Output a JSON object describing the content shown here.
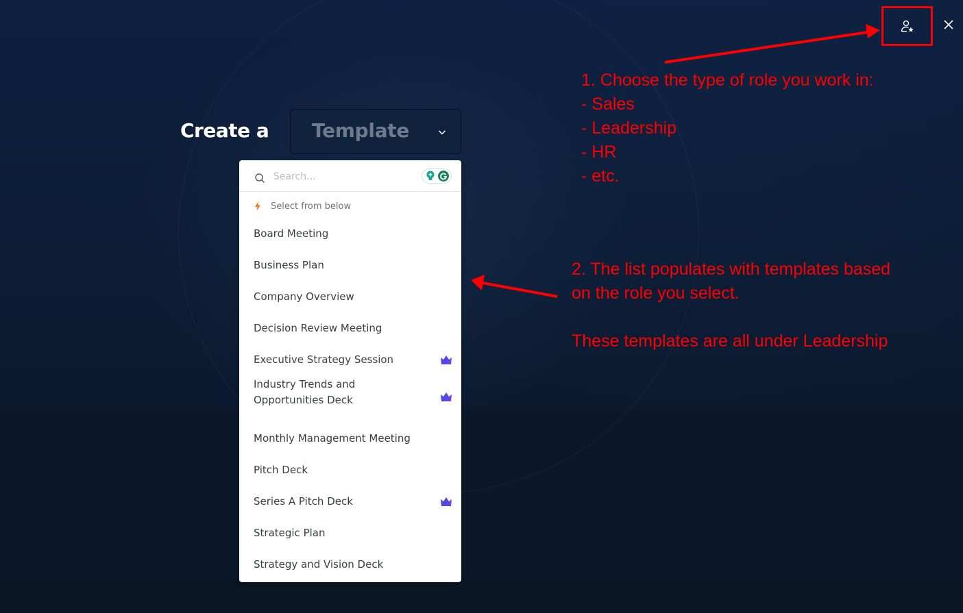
{
  "header": {
    "create_label": "Create a",
    "type_select": {
      "value": "Template",
      "icon": "chevron-down-icon"
    }
  },
  "top_controls": {
    "role_button": {
      "icon": "user-star-icon",
      "label": "Choose role"
    },
    "close_button": {
      "icon": "close-icon"
    }
  },
  "dropdown": {
    "search": {
      "placeholder": "Search...",
      "value": "",
      "icon": "search-icon"
    },
    "extensions": [
      {
        "name": "lightbulb-extension-icon",
        "color": "#15a88f"
      },
      {
        "name": "grammarly-extension-icon",
        "color": "#15835e"
      }
    ],
    "hint": {
      "icon": "lightning-icon",
      "text": "Select from below",
      "icon_color": "#f27a2a"
    },
    "items": [
      {
        "label": "Board Meeting",
        "premium": false
      },
      {
        "label": "Business Plan",
        "premium": false
      },
      {
        "label": "Company Overview",
        "premium": false
      },
      {
        "label": "Decision Review Meeting",
        "premium": false
      },
      {
        "label": "Executive Strategy Session",
        "premium": true
      },
      {
        "label": "Industry Trends and Opportunities Deck",
        "premium": true
      },
      {
        "label": "Monthly Management Meeting",
        "premium": false
      },
      {
        "label": "Pitch Deck",
        "premium": false
      },
      {
        "label": "Series A Pitch Deck",
        "premium": true
      },
      {
        "label": "Strategic Plan",
        "premium": false
      },
      {
        "label": "Strategy and Vision Deck",
        "premium": false
      }
    ],
    "premium_icon": "crown-icon",
    "premium_color": "#5a46e6"
  },
  "annotations": {
    "note1": [
      "1. Choose the type of role you work in:",
      "- Sales",
      "- Leadership",
      "- HR",
      "- etc."
    ],
    "note2": [
      "2. The list populates with templates based",
      "on the role you select."
    ],
    "note3": "These templates are all under Leadership",
    "color": "#ff0000"
  }
}
